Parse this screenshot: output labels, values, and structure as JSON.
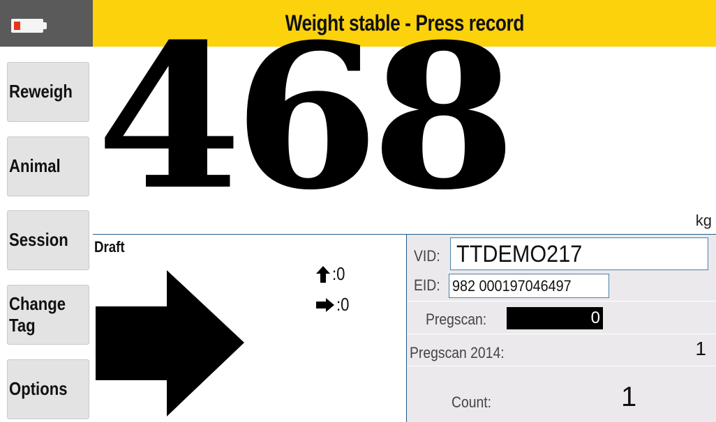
{
  "header": {
    "status": "Weight stable - Press record",
    "battery_icon": "battery-low-icon",
    "battery_level_color": "#e8351a",
    "status_color": "#fcd20d"
  },
  "sidebar": {
    "items": [
      {
        "label": "Reweigh"
      },
      {
        "label": "Animal"
      },
      {
        "label": "Session"
      },
      {
        "label": "Change Tag"
      },
      {
        "label": "Options"
      }
    ]
  },
  "weight": {
    "value": "468",
    "unit": "kg"
  },
  "draft": {
    "label": "Draft",
    "direction_icon": "arrow-right-icon",
    "counts": [
      {
        "icon": "arrow-up-icon",
        "value": ":0"
      },
      {
        "icon": "arrow-right-icon",
        "value": ":0"
      }
    ]
  },
  "animal": {
    "vid_label": "VID:",
    "vid_value": "TTDEMO217",
    "eid_label": "EID:",
    "eid_value": "982 000197046497",
    "pregscan_label": "Pregscan:",
    "pregscan_value": "0",
    "pregscan2014_label": "Pregscan 2014:",
    "pregscan2014_value": "1",
    "count_label": "Count:",
    "count_value": "1"
  }
}
